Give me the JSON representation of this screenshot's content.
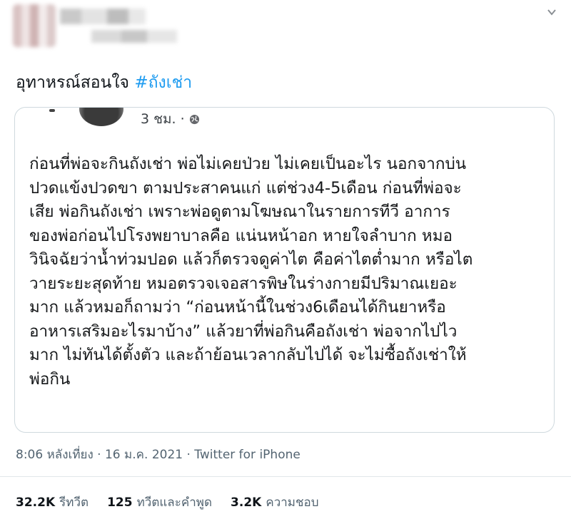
{
  "tweet": {
    "text_prefix": "อุทาหรณ์สอนใจ ",
    "hashtag": "#ถังเช่า",
    "hashtag_color": "#1d9bf0"
  },
  "quoted_post": {
    "time": "3 ชม. ·",
    "audience_icon": "globe-icon",
    "lines": [
      "ก่อนที่พ่อจะกินถังเช่า พ่อไม่เคยป่วย ไม่เคยเป็นอะไร นอกจากบ่น",
      "ปวดแข้งปวดขา ตามประสาคนแก่ แต่ช่วง4-5เดือน ก่อนที่พ่อจะ",
      "เสีย พ่อกินถังเช่า เพราะพ่อดูตามโฆษณาในรายการทีวี อาการ",
      "ของพ่อก่อนไปโรงพยาบาลคือ แน่นหน้าอก หายใจลำบาก หมอ",
      "วินิจฉัยว่าน้ำท่วมปอด แล้วก็ตรวจดูค่าไต คือค่าไตต่ำมาก หรือไต",
      "วายระยะสุดท้าย หมอตรวจเจอสารพิษในร่างกายมีปริมาณเยอะ",
      "มาก แล้วหมอก็ถามว่า “ก่อนหน้านี้ในช่วง6เดือนได้กินยาหรือ",
      "อาหารเสริมอะไรมาบ้าง” แล้วยาที่พ่อกินคือถังเช่า พ่อจากไปไว",
      "มาก ไม่ทันได้ตั้งตัว และถ้าย้อนเวลากลับไปได้ จะไม่ซื้อถังเช่าให้",
      "พ่อกิน"
    ]
  },
  "meta": {
    "timestamp": "8:06 หลังเที่ยง · 16 ม.ค. 2021 · Twitter for iPhone"
  },
  "stats": {
    "retweets_count": "32.2K",
    "retweets_label": "รีทวีต",
    "quotes_count": "125",
    "quotes_label": "ทวีตและคำพูด",
    "likes_count": "3.2K",
    "likes_label": "ความชอบ"
  }
}
